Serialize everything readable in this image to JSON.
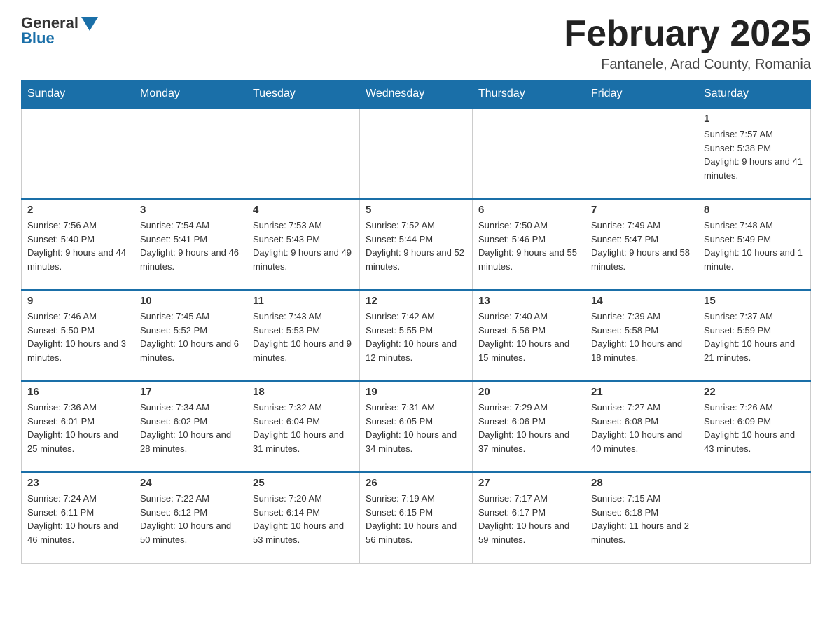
{
  "logo": {
    "general": "General",
    "blue": "Blue"
  },
  "header": {
    "month_title": "February 2025",
    "subtitle": "Fantanele, Arad County, Romania"
  },
  "days_of_week": [
    "Sunday",
    "Monday",
    "Tuesday",
    "Wednesday",
    "Thursday",
    "Friday",
    "Saturday"
  ],
  "weeks": [
    [
      {
        "day": "",
        "info": ""
      },
      {
        "day": "",
        "info": ""
      },
      {
        "day": "",
        "info": ""
      },
      {
        "day": "",
        "info": ""
      },
      {
        "day": "",
        "info": ""
      },
      {
        "day": "",
        "info": ""
      },
      {
        "day": "1",
        "info": "Sunrise: 7:57 AM\nSunset: 5:38 PM\nDaylight: 9 hours and 41 minutes."
      }
    ],
    [
      {
        "day": "2",
        "info": "Sunrise: 7:56 AM\nSunset: 5:40 PM\nDaylight: 9 hours and 44 minutes."
      },
      {
        "day": "3",
        "info": "Sunrise: 7:54 AM\nSunset: 5:41 PM\nDaylight: 9 hours and 46 minutes."
      },
      {
        "day": "4",
        "info": "Sunrise: 7:53 AM\nSunset: 5:43 PM\nDaylight: 9 hours and 49 minutes."
      },
      {
        "day": "5",
        "info": "Sunrise: 7:52 AM\nSunset: 5:44 PM\nDaylight: 9 hours and 52 minutes."
      },
      {
        "day": "6",
        "info": "Sunrise: 7:50 AM\nSunset: 5:46 PM\nDaylight: 9 hours and 55 minutes."
      },
      {
        "day": "7",
        "info": "Sunrise: 7:49 AM\nSunset: 5:47 PM\nDaylight: 9 hours and 58 minutes."
      },
      {
        "day": "8",
        "info": "Sunrise: 7:48 AM\nSunset: 5:49 PM\nDaylight: 10 hours and 1 minute."
      }
    ],
    [
      {
        "day": "9",
        "info": "Sunrise: 7:46 AM\nSunset: 5:50 PM\nDaylight: 10 hours and 3 minutes."
      },
      {
        "day": "10",
        "info": "Sunrise: 7:45 AM\nSunset: 5:52 PM\nDaylight: 10 hours and 6 minutes."
      },
      {
        "day": "11",
        "info": "Sunrise: 7:43 AM\nSunset: 5:53 PM\nDaylight: 10 hours and 9 minutes."
      },
      {
        "day": "12",
        "info": "Sunrise: 7:42 AM\nSunset: 5:55 PM\nDaylight: 10 hours and 12 minutes."
      },
      {
        "day": "13",
        "info": "Sunrise: 7:40 AM\nSunset: 5:56 PM\nDaylight: 10 hours and 15 minutes."
      },
      {
        "day": "14",
        "info": "Sunrise: 7:39 AM\nSunset: 5:58 PM\nDaylight: 10 hours and 18 minutes."
      },
      {
        "day": "15",
        "info": "Sunrise: 7:37 AM\nSunset: 5:59 PM\nDaylight: 10 hours and 21 minutes."
      }
    ],
    [
      {
        "day": "16",
        "info": "Sunrise: 7:36 AM\nSunset: 6:01 PM\nDaylight: 10 hours and 25 minutes."
      },
      {
        "day": "17",
        "info": "Sunrise: 7:34 AM\nSunset: 6:02 PM\nDaylight: 10 hours and 28 minutes."
      },
      {
        "day": "18",
        "info": "Sunrise: 7:32 AM\nSunset: 6:04 PM\nDaylight: 10 hours and 31 minutes."
      },
      {
        "day": "19",
        "info": "Sunrise: 7:31 AM\nSunset: 6:05 PM\nDaylight: 10 hours and 34 minutes."
      },
      {
        "day": "20",
        "info": "Sunrise: 7:29 AM\nSunset: 6:06 PM\nDaylight: 10 hours and 37 minutes."
      },
      {
        "day": "21",
        "info": "Sunrise: 7:27 AM\nSunset: 6:08 PM\nDaylight: 10 hours and 40 minutes."
      },
      {
        "day": "22",
        "info": "Sunrise: 7:26 AM\nSunset: 6:09 PM\nDaylight: 10 hours and 43 minutes."
      }
    ],
    [
      {
        "day": "23",
        "info": "Sunrise: 7:24 AM\nSunset: 6:11 PM\nDaylight: 10 hours and 46 minutes."
      },
      {
        "day": "24",
        "info": "Sunrise: 7:22 AM\nSunset: 6:12 PM\nDaylight: 10 hours and 50 minutes."
      },
      {
        "day": "25",
        "info": "Sunrise: 7:20 AM\nSunset: 6:14 PM\nDaylight: 10 hours and 53 minutes."
      },
      {
        "day": "26",
        "info": "Sunrise: 7:19 AM\nSunset: 6:15 PM\nDaylight: 10 hours and 56 minutes."
      },
      {
        "day": "27",
        "info": "Sunrise: 7:17 AM\nSunset: 6:17 PM\nDaylight: 10 hours and 59 minutes."
      },
      {
        "day": "28",
        "info": "Sunrise: 7:15 AM\nSunset: 6:18 PM\nDaylight: 11 hours and 2 minutes."
      },
      {
        "day": "",
        "info": ""
      }
    ]
  ]
}
